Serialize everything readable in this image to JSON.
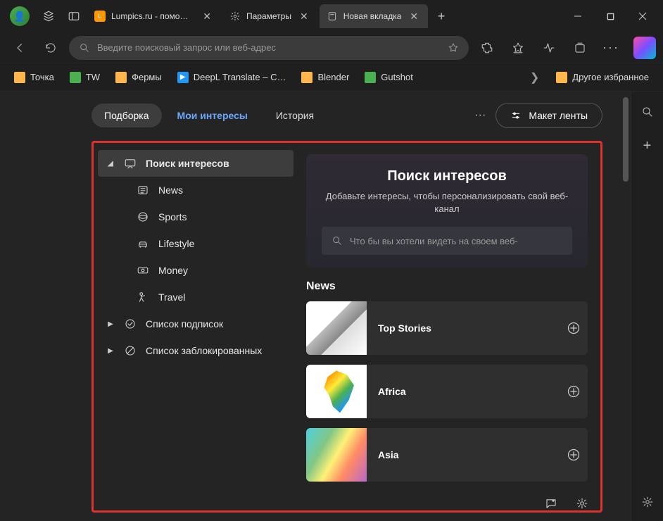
{
  "window": {
    "tabs": [
      {
        "label": "Lumpics.ru - помощь с"
      },
      {
        "label": "Параметры"
      },
      {
        "label": "Новая вкладка"
      }
    ],
    "new_tab_tooltip": "+"
  },
  "toolbar": {
    "address_placeholder": "Введите поисковый запрос или веб-адрес"
  },
  "bookmarks": {
    "items": [
      {
        "label": "Точка",
        "icon": "yellow"
      },
      {
        "label": "TW",
        "icon": "green"
      },
      {
        "label": "Фермы",
        "icon": "yellow"
      },
      {
        "label": "DeepL Translate – C…",
        "icon": "blue"
      },
      {
        "label": "Blender",
        "icon": "orange"
      },
      {
        "label": "Gutshot",
        "icon": "green"
      }
    ],
    "other": "Другое избранное"
  },
  "feed_header": {
    "podborka": "Подборка",
    "interests": "Мои интересы",
    "history": "История",
    "layout_btn": "Макет ленты"
  },
  "sidebar": {
    "search_interests": "Поиск интересов",
    "categories": [
      {
        "label": "News"
      },
      {
        "label": "Sports"
      },
      {
        "label": "Lifestyle"
      },
      {
        "label": "Money"
      },
      {
        "label": "Travel"
      }
    ],
    "subscriptions": "Список подписок",
    "blocked": "Список заблокированных"
  },
  "hero": {
    "title": "Поиск интересов",
    "subtitle": "Добавьте интересы, чтобы персонализировать свой веб-канал",
    "search_placeholder": "Что бы вы хотели видеть на своем веб-"
  },
  "section": {
    "title": "News",
    "cards": [
      {
        "title": "Top Stories"
      },
      {
        "title": "Africa"
      },
      {
        "title": "Asia"
      }
    ]
  }
}
